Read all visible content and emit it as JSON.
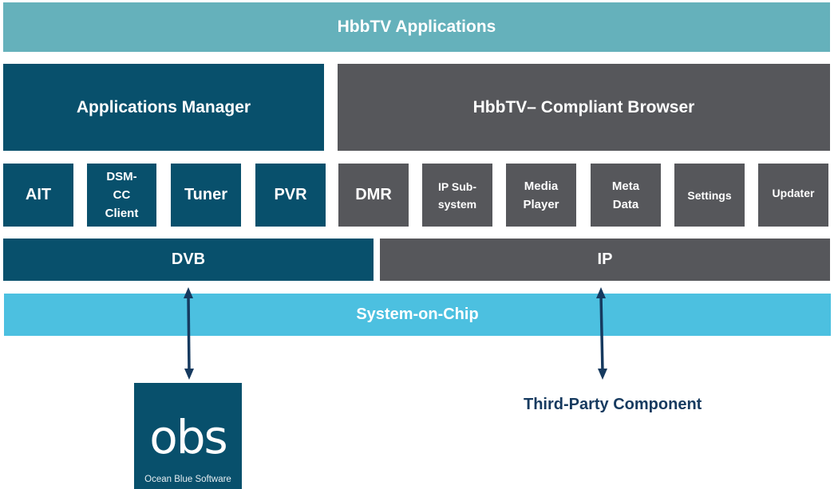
{
  "diagram": {
    "top_layer": {
      "label": "HbbTV Applications"
    },
    "middle_layer": {
      "left": {
        "label": "Applications Manager"
      },
      "right": {
        "label": "HbbTV– Compliant Browser"
      }
    },
    "components": {
      "broadcast": [
        {
          "label": "AIT"
        },
        {
          "label": "DSM-CC Client"
        },
        {
          "label": "Tuner"
        },
        {
          "label": "PVR"
        }
      ],
      "broadband": [
        {
          "label": "DMR"
        },
        {
          "label": "IP Sub-system"
        },
        {
          "label": "Media Player"
        },
        {
          "label": "Meta Data"
        },
        {
          "label": "Settings"
        },
        {
          "label": "Updater"
        }
      ]
    },
    "transport_layer": {
      "left": {
        "label": "DVB"
      },
      "right": {
        "label": "IP"
      }
    },
    "soc_layer": {
      "label": "System-on-Chip"
    },
    "external": {
      "left_logo": {
        "mark": "obs",
        "tagline": "Ocean Blue Software"
      },
      "right": {
        "label": "Third-Party Component"
      }
    },
    "connectors": [
      {
        "from": "DVB",
        "to": "Ocean Blue Software",
        "type": "bidirectional-arrow"
      },
      {
        "from": "IP",
        "to": "Third-Party Component",
        "type": "bidirectional-arrow"
      }
    ],
    "colors": {
      "applications": "#65b1bb",
      "broadcast": "#08506c",
      "broadband": "#56575b",
      "soc": "#4cc0e0",
      "arrow": "#163a5f",
      "text_dark": "#163a5f"
    }
  }
}
